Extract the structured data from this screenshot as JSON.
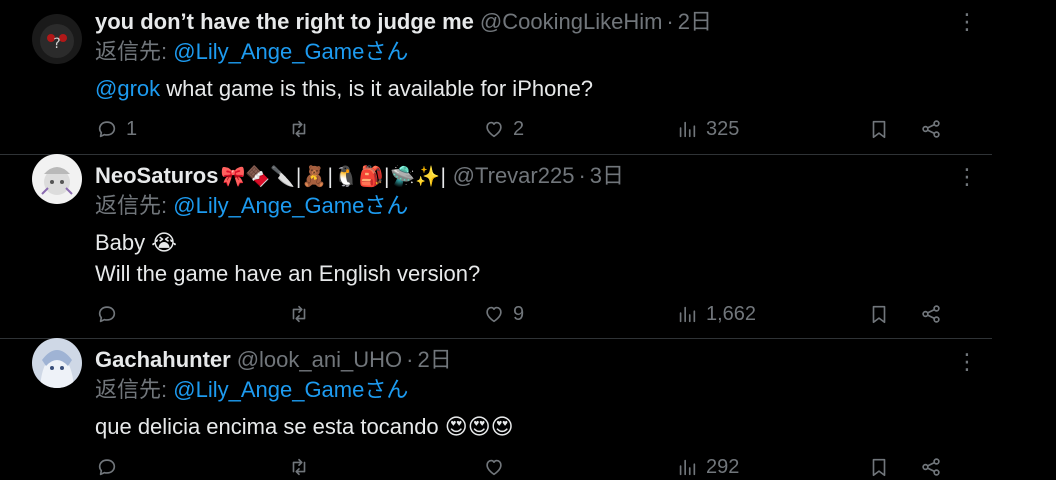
{
  "reply_prefix": "返信先:",
  "tweets": [
    {
      "name": "you don’t have the right to judge me",
      "handle": "@CookingLikeHim",
      "time": "2日",
      "reply_to": "@Lily_Ange_Gameさん",
      "body_mention": "@grok",
      "body_lines": [
        "what game is this, is it available for iPhone?"
      ],
      "replies": "1",
      "retweets": "",
      "likes": "2",
      "views": "325"
    },
    {
      "name": "NeoSaturos",
      "name_emoji": "🎀🍫🔪|🧸|🐧🎒|🛸✨|",
      "handle": "@Trevar225",
      "time": "3日",
      "reply_to": "@Lily_Ange_Gameさん",
      "body_lines": [
        "Baby 😭",
        "Will the game have an English version?"
      ],
      "replies": "",
      "retweets": "",
      "likes": "9",
      "views": "1,662"
    },
    {
      "name": "Gachahunter",
      "handle": "@look_ani_UHO",
      "time": "2日",
      "reply_to": "@Lily_Ange_Gameさん",
      "body_lines": [
        "que delicia encima se esta tocando 😍😍😍"
      ],
      "replies": "",
      "retweets": "",
      "likes": "",
      "views": "292"
    }
  ],
  "icons": {
    "reply": "reply-icon",
    "retweet": "retweet-icon",
    "like": "heart-icon",
    "views": "views-icon",
    "bookmark": "bookmark-icon",
    "share": "share-icon",
    "more": "more-options-icon"
  },
  "colors": {
    "background": "#000000",
    "text": "#e7e9ea",
    "secondary": "#71767b",
    "link": "#1d9bf0",
    "divider": "#2f3336"
  }
}
